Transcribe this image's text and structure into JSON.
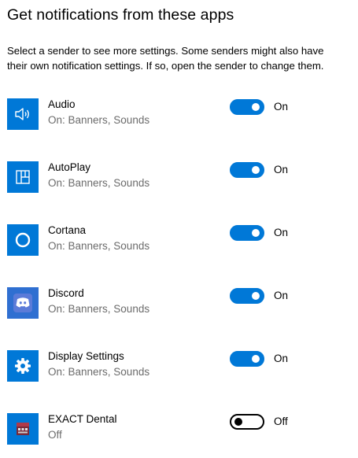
{
  "section": {
    "title": "Get notifications from these apps",
    "description_line1": "Select a sender to see more settings. Some senders might also have",
    "description_line2": "their own notification settings. If so, open the sender to change them."
  },
  "colors": {
    "accent": "#0078d7",
    "secondary_text": "#6b6b6b"
  },
  "apps": [
    {
      "name": "Audio",
      "status": "On: Banners, Sounds",
      "toggle_label": "On",
      "enabled": true,
      "icon": "speaker-icon"
    },
    {
      "name": "AutoPlay",
      "status": "On: Banners, Sounds",
      "toggle_label": "On",
      "enabled": true,
      "icon": "autoplay-icon"
    },
    {
      "name": "Cortana",
      "status": "On: Banners, Sounds",
      "toggle_label": "On",
      "enabled": true,
      "icon": "cortana-icon"
    },
    {
      "name": "Discord",
      "status": "On: Banners, Sounds",
      "toggle_label": "On",
      "enabled": true,
      "icon": "discord-icon"
    },
    {
      "name": "Display Settings",
      "status": "On: Banners, Sounds",
      "toggle_label": "On",
      "enabled": true,
      "icon": "gear-icon"
    },
    {
      "name": "EXACT Dental",
      "status": "Off",
      "toggle_label": "Off",
      "enabled": false,
      "icon": "exact-dental-icon"
    }
  ]
}
